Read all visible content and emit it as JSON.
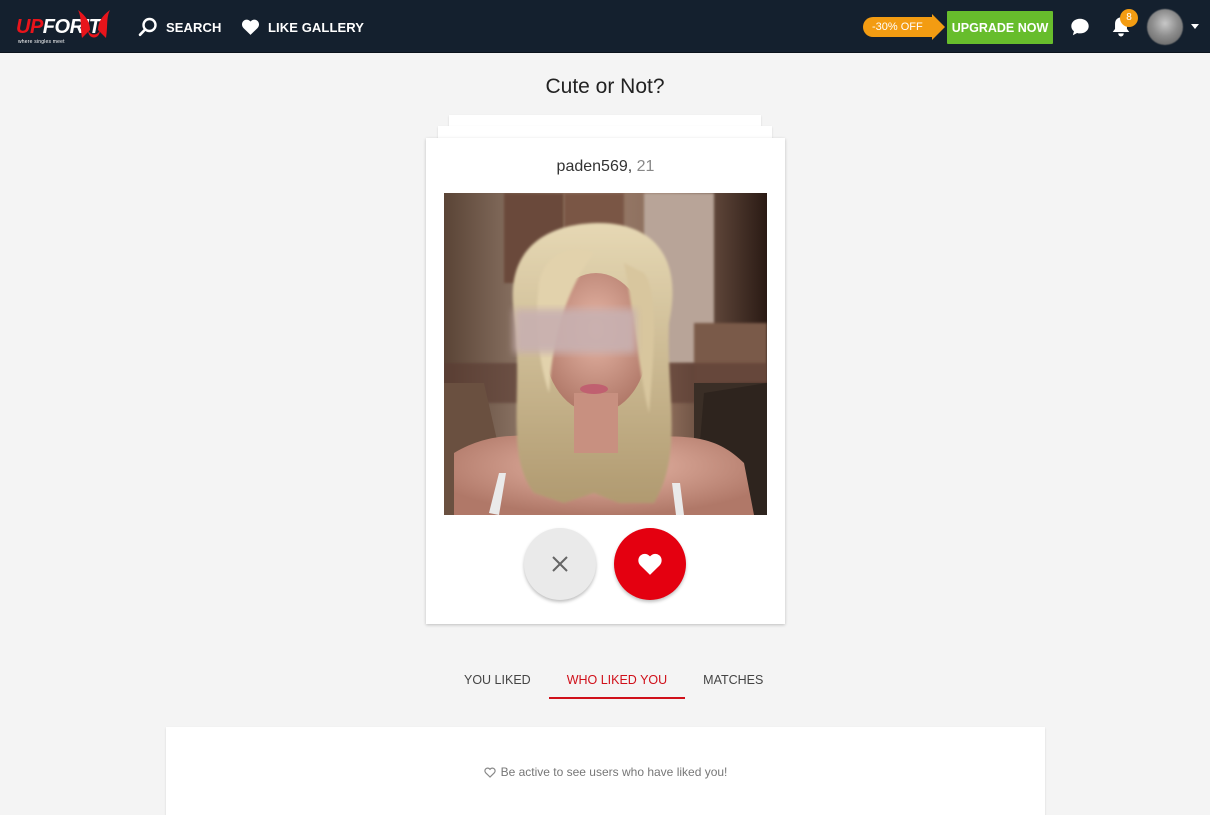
{
  "header": {
    "logo": {
      "up": "UP",
      "for": "FOR",
      "it": "IT",
      "tagline": "where singles meet"
    },
    "nav": [
      {
        "label": "SEARCH",
        "icon": "search-icon"
      },
      {
        "label": "LIKE GALLERY",
        "icon": "heart-icon"
      }
    ],
    "discount_label": "-30% OFF",
    "upgrade_label": "UPGRADE NOW",
    "notification_count": "8",
    "colors": {
      "bar": "#14202e",
      "upgrade": "#67bd2c",
      "discount": "#f39c12",
      "accent": "#e40010"
    }
  },
  "main": {
    "title": "Cute or Not?",
    "profile": {
      "username": "paden569,",
      "age": "21"
    },
    "tabs": [
      {
        "label": "YOU LIKED",
        "active": false
      },
      {
        "label": "WHO LIKED YOU",
        "active": true
      },
      {
        "label": "MATCHES",
        "active": false
      }
    ],
    "panel_message": "Be active to see users who have liked you!"
  }
}
